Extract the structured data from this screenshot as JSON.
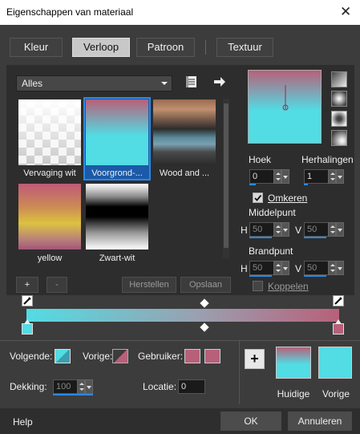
{
  "window": {
    "title": "Eigenschappen van materiaal",
    "close": "✕"
  },
  "tabs": [
    {
      "label": "Kleur"
    },
    {
      "label": "Verloop"
    },
    {
      "label": "Patroon"
    },
    {
      "label": "Textuur"
    }
  ],
  "category": {
    "value": "Alles"
  },
  "thumbs": [
    {
      "label": "Vervaging wit"
    },
    {
      "label": "Voorgrond-..."
    },
    {
      "label": "Wood and ..."
    },
    {
      "label": "yellow"
    },
    {
      "label": "Zwart-wit"
    }
  ],
  "buttons": {
    "add": "+",
    "remove": "-",
    "reset": "Herstellen",
    "save": "Opslaan",
    "ok": "OK",
    "cancel": "Annuleren",
    "help": "Help",
    "plus": "+"
  },
  "angle": {
    "label": "Hoek",
    "value": "0"
  },
  "repeats": {
    "label": "Herhalingen",
    "value": "1"
  },
  "invert": {
    "label": "Omkeren",
    "checked": true
  },
  "center": {
    "label": "Middelpunt",
    "h_label": "H",
    "h": "50",
    "v_label": "V",
    "v": "50"
  },
  "focal": {
    "label": "Brandpunt",
    "h_label": "H",
    "h": "50",
    "v_label": "V",
    "v": "50"
  },
  "link": {
    "label": "Koppelen"
  },
  "stops": {
    "next_label": "Volgende:",
    "prev_label": "Vorige:",
    "user_label": "Gebruiker:",
    "opacity_label": "Dekking:",
    "opacity": "100",
    "location_label": "Locatie:",
    "location": "0"
  },
  "preview": {
    "current_label": "Huidige",
    "previous_label": "Vorige"
  },
  "colors": {
    "pink": "#b8607a",
    "cyan": "#52dce4"
  }
}
